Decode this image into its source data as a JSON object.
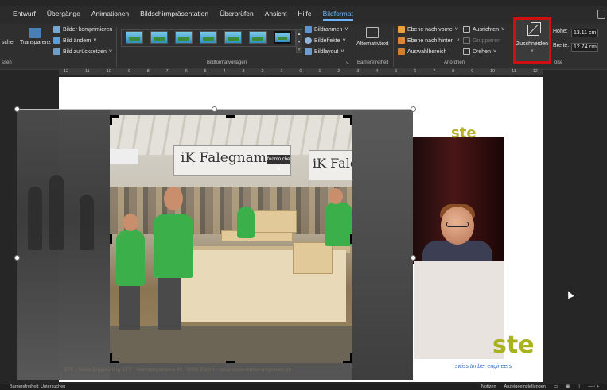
{
  "tabs": [
    "Entwurf",
    "Übergänge",
    "Animationen",
    "Bildschirmpräsentation",
    "Überprüfen",
    "Ansicht",
    "Hilfe",
    "Bildformat"
  ],
  "active_tab": "Bildformat",
  "ribbon": {
    "anpassen": {
      "partial_left": "sche",
      "transparenz": "Transparenz",
      "bilder_komprimieren": "Bilder komprimieren",
      "bild_aendern": "Bild ändern",
      "bild_zuruecksetzen": "Bild zurücksetzen",
      "group_label": "ssen"
    },
    "bildformatvorlagen": {
      "group_label": "Bildformatvorlagen",
      "bildrahmen": "Bildrahmen",
      "bildeffekte": "Bildeffekte",
      "bildlayout": "Bildlayout"
    },
    "barrierefreiheit": {
      "alternativtext": "Alternativtext",
      "group_label": "Barrierefreiheit"
    },
    "anordnen": {
      "ebene_vorne": "Ebene nach vorne",
      "ebene_hinten": "Ebene nach hinten",
      "auswahlbereich": "Auswahlbereich",
      "ausrichten": "Ausrichten",
      "gruppieren": "Gruppieren",
      "drehen": "Drehen",
      "group_label": "Anordnen"
    },
    "zuschneiden": "Zuschneiden",
    "groesse": {
      "hoehe_label": "Höhe:",
      "hoehe_value": "13.11 cm",
      "breite_label": "Breite:",
      "breite_value": "12.74 cm",
      "group_label": "öße"
    }
  },
  "ruler": [
    "12",
    "11",
    "10",
    "9",
    "8",
    "7",
    "6",
    "5",
    "4",
    "3",
    "2",
    "1",
    "0",
    "1",
    "2",
    "3",
    "4",
    "5",
    "6",
    "7",
    "8",
    "9",
    "10",
    "11",
    "12"
  ],
  "slide": {
    "banner_main": "iK Falegname",
    "banner_sub": "l'uomo che fa",
    "banner_right": "iK Falegna",
    "footer": "STE | Swiss Engineering STV · Weinbergstrasse 41 · 8006 Zürich · www.swiss-timber-engineers.ch",
    "logo_text": "swiss timber engineers",
    "logo_glyph": "ste"
  },
  "status": {
    "accessibility": "Barrierefreiheit: Untersuchen",
    "notes": "Notizen",
    "display_settings": "Anzeigeeinstellungen"
  },
  "colors": {
    "accent": "#6fb3ff",
    "highlight": "#d01010",
    "ste_green": "#a8b21c",
    "ste_blue": "#2d6bb4"
  }
}
